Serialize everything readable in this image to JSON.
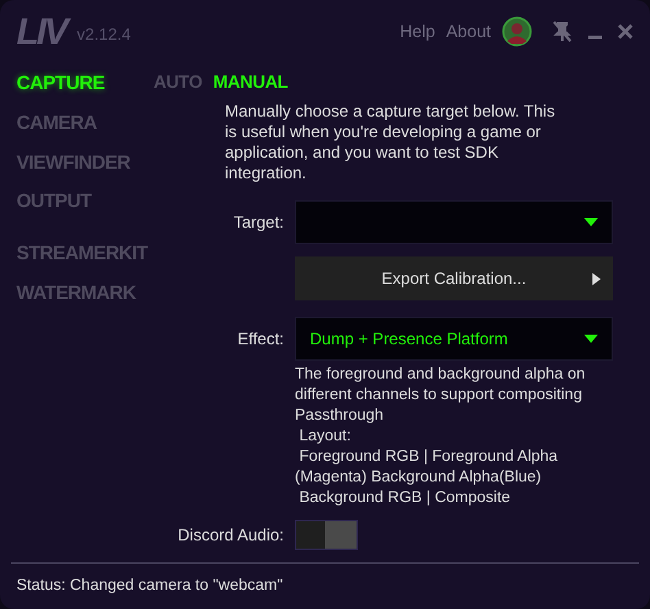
{
  "header": {
    "logo": "LIV",
    "version": "v2.12.4",
    "links": [
      "Help",
      "About"
    ]
  },
  "sidebar": {
    "groups": [
      {
        "items": [
          {
            "label": "CAPTURE",
            "selected": true
          },
          {
            "label": "CAMERA",
            "selected": false
          },
          {
            "label": "VIEWFINDER",
            "selected": false
          },
          {
            "label": "OUTPUT",
            "selected": false
          }
        ]
      },
      {
        "items": [
          {
            "label": "STREAMERKIT",
            "selected": false
          },
          {
            "label": "WATERMARK",
            "selected": false
          }
        ]
      }
    ]
  },
  "tabs": [
    {
      "label": "AUTO",
      "selected": false
    },
    {
      "label": "MANUAL",
      "selected": true
    }
  ],
  "intro": "Manually choose a capture target below. This is useful when you're developing a game or application, and you want to test SDK integration.",
  "fields": [
    {
      "kind": "select",
      "label": "Target:"
    },
    {
      "kind": "button",
      "text": "Export Calibration..."
    },
    {
      "kind": "select",
      "label": "Effect:",
      "value": "Dump + Presence Platform"
    },
    {
      "kind": "note",
      "text": "The foreground and background alpha on different channels to support compositing Passthrough\n Layout:\n Foreground RGB | Foreground Alpha (Magenta) Background Alpha(Blue)\n Background RGB | Composite"
    },
    {
      "kind": "switch",
      "label": "Discord Audio:",
      "on": false
    }
  ],
  "status_bar": "Status: Changed camera to \"webcam\""
}
